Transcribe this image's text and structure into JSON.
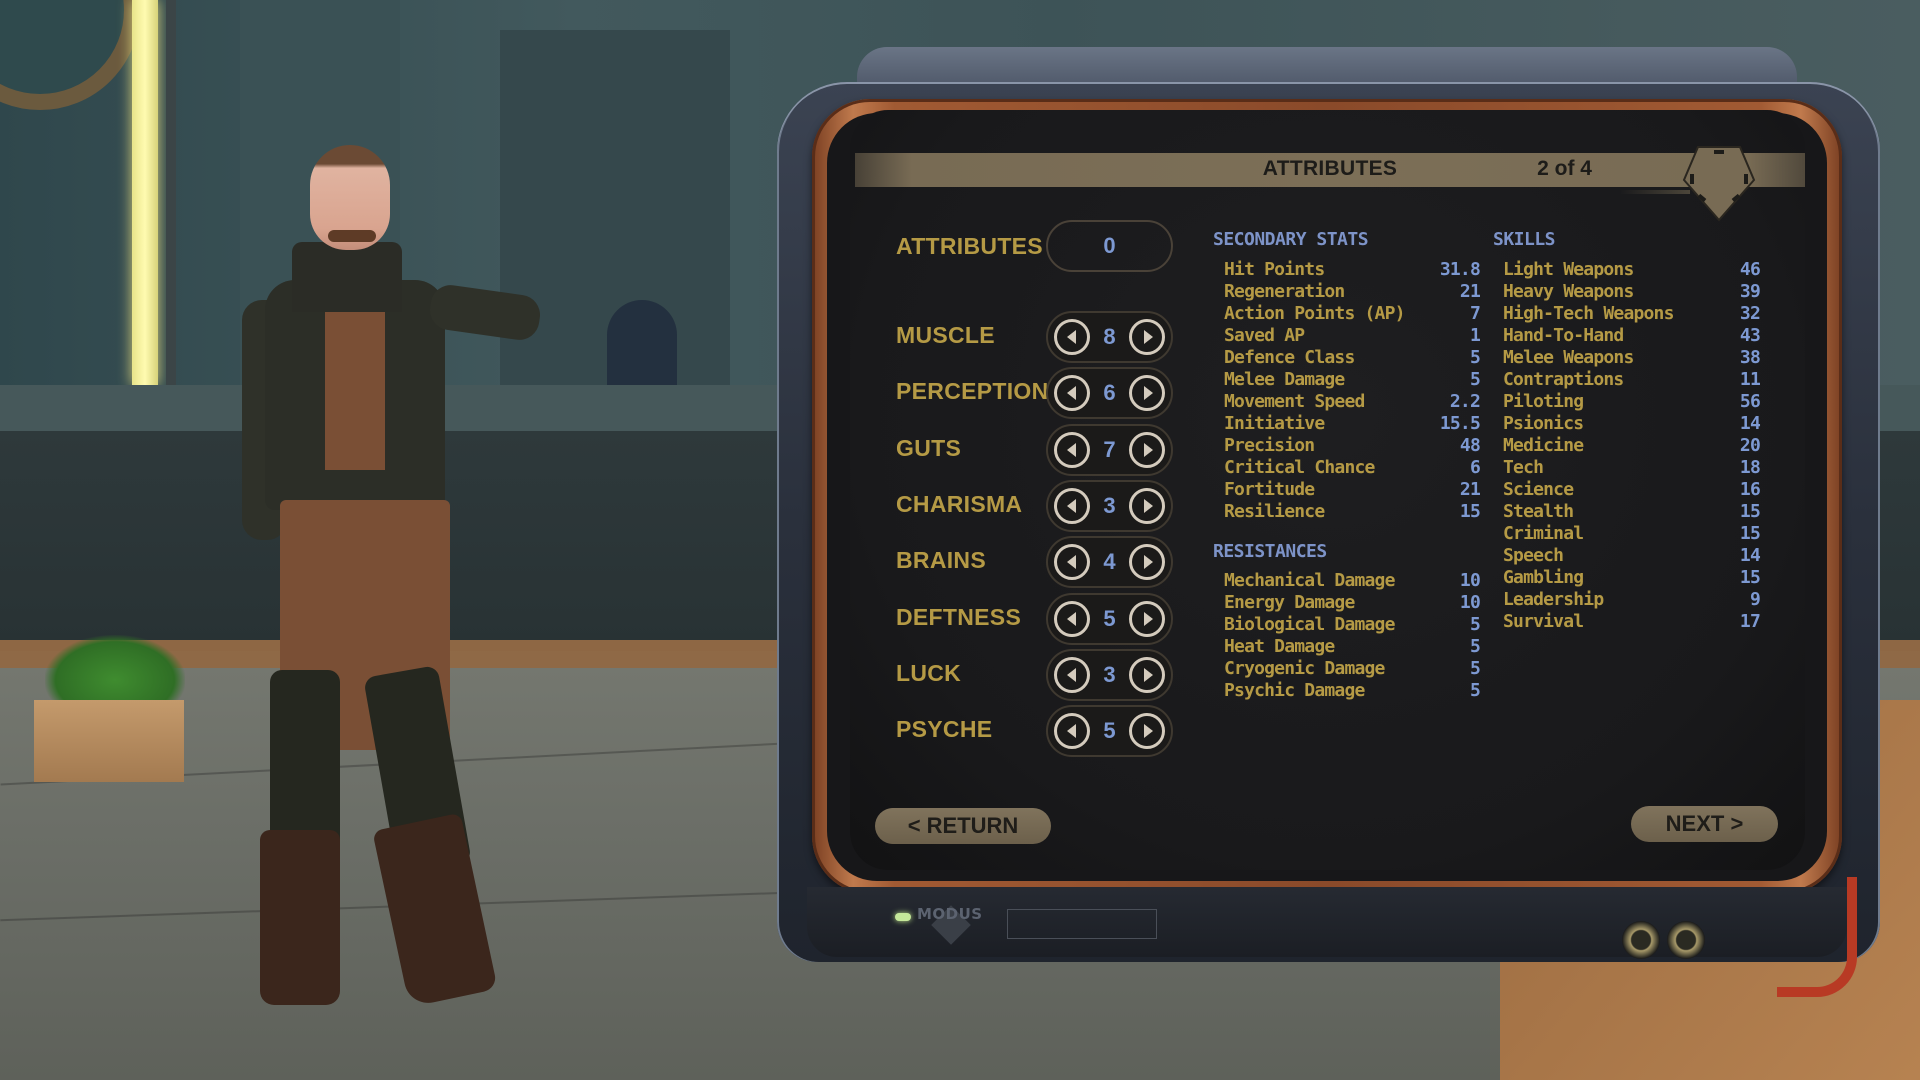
{
  "panel": {
    "title": "ATTRIBUTES",
    "page_indicator": "2 of 4",
    "emblem_icon": "pentagon-emblem-icon"
  },
  "attributes": {
    "points_label": "ATTRIBUTES",
    "points_remaining": "0",
    "items": [
      {
        "label": "MUSCLE",
        "value": "8"
      },
      {
        "label": "PERCEPTION",
        "value": "6"
      },
      {
        "label": "GUTS",
        "value": "7"
      },
      {
        "label": "CHARISMA",
        "value": "3"
      },
      {
        "label": "BRAINS",
        "value": "4"
      },
      {
        "label": "DEFTNESS",
        "value": "5"
      },
      {
        "label": "LUCK",
        "value": "3"
      },
      {
        "label": "PSYCHE",
        "value": "5"
      }
    ]
  },
  "secondary_stats": {
    "heading": "SECONDARY STATS",
    "items": [
      {
        "label": "Hit Points",
        "value": "31.8"
      },
      {
        "label": "Regeneration",
        "value": "21"
      },
      {
        "label": "Action Points (AP)",
        "value": "7"
      },
      {
        "label": "Saved AP",
        "value": "1"
      },
      {
        "label": "Defence Class",
        "value": "5"
      },
      {
        "label": "Melee Damage",
        "value": "5"
      },
      {
        "label": "Movement Speed",
        "value": "2.2"
      },
      {
        "label": "Initiative",
        "value": "15.5"
      },
      {
        "label": "Precision",
        "value": "48"
      },
      {
        "label": "Critical Chance",
        "value": "6"
      },
      {
        "label": "Fortitude",
        "value": "21"
      },
      {
        "label": "Resilience",
        "value": "15"
      }
    ]
  },
  "resistances": {
    "heading": "RESISTANCES",
    "items": [
      {
        "label": "Mechanical Damage",
        "value": "10"
      },
      {
        "label": "Energy Damage",
        "value": "10"
      },
      {
        "label": "Biological Damage",
        "value": "5"
      },
      {
        "label": "Heat Damage",
        "value": "5"
      },
      {
        "label": "Cryogenic Damage",
        "value": "5"
      },
      {
        "label": "Psychic Damage",
        "value": "5"
      }
    ]
  },
  "skills": {
    "heading": "SKILLS",
    "items": [
      {
        "label": "Light Weapons",
        "value": "46"
      },
      {
        "label": "Heavy Weapons",
        "value": "39"
      },
      {
        "label": "High-Tech Weapons",
        "value": "32"
      },
      {
        "label": "Hand-To-Hand",
        "value": "43"
      },
      {
        "label": "Melee Weapons",
        "value": "38"
      },
      {
        "label": "Contraptions",
        "value": "11"
      },
      {
        "label": "Piloting",
        "value": "56"
      },
      {
        "label": "Psionics",
        "value": "14"
      },
      {
        "label": "Medicine",
        "value": "20"
      },
      {
        "label": "Tech",
        "value": "18"
      },
      {
        "label": "Science",
        "value": "16"
      },
      {
        "label": "Stealth",
        "value": "15"
      },
      {
        "label": "Criminal",
        "value": "15"
      },
      {
        "label": "Speech",
        "value": "14"
      },
      {
        "label": "Gambling",
        "value": "15"
      },
      {
        "label": "Leadership",
        "value": "9"
      },
      {
        "label": "Survival",
        "value": "17"
      }
    ]
  },
  "nav": {
    "return_label": "< RETURN",
    "next_label": "NEXT >"
  },
  "device": {
    "brand": "MODUS"
  },
  "colors": {
    "label_gold": "#b59a45",
    "value_blue": "#7d99d2",
    "heading_blue": "#7d93c8",
    "titlebar_tan": "#7c6f57",
    "copper_frame": "#a15a33"
  }
}
